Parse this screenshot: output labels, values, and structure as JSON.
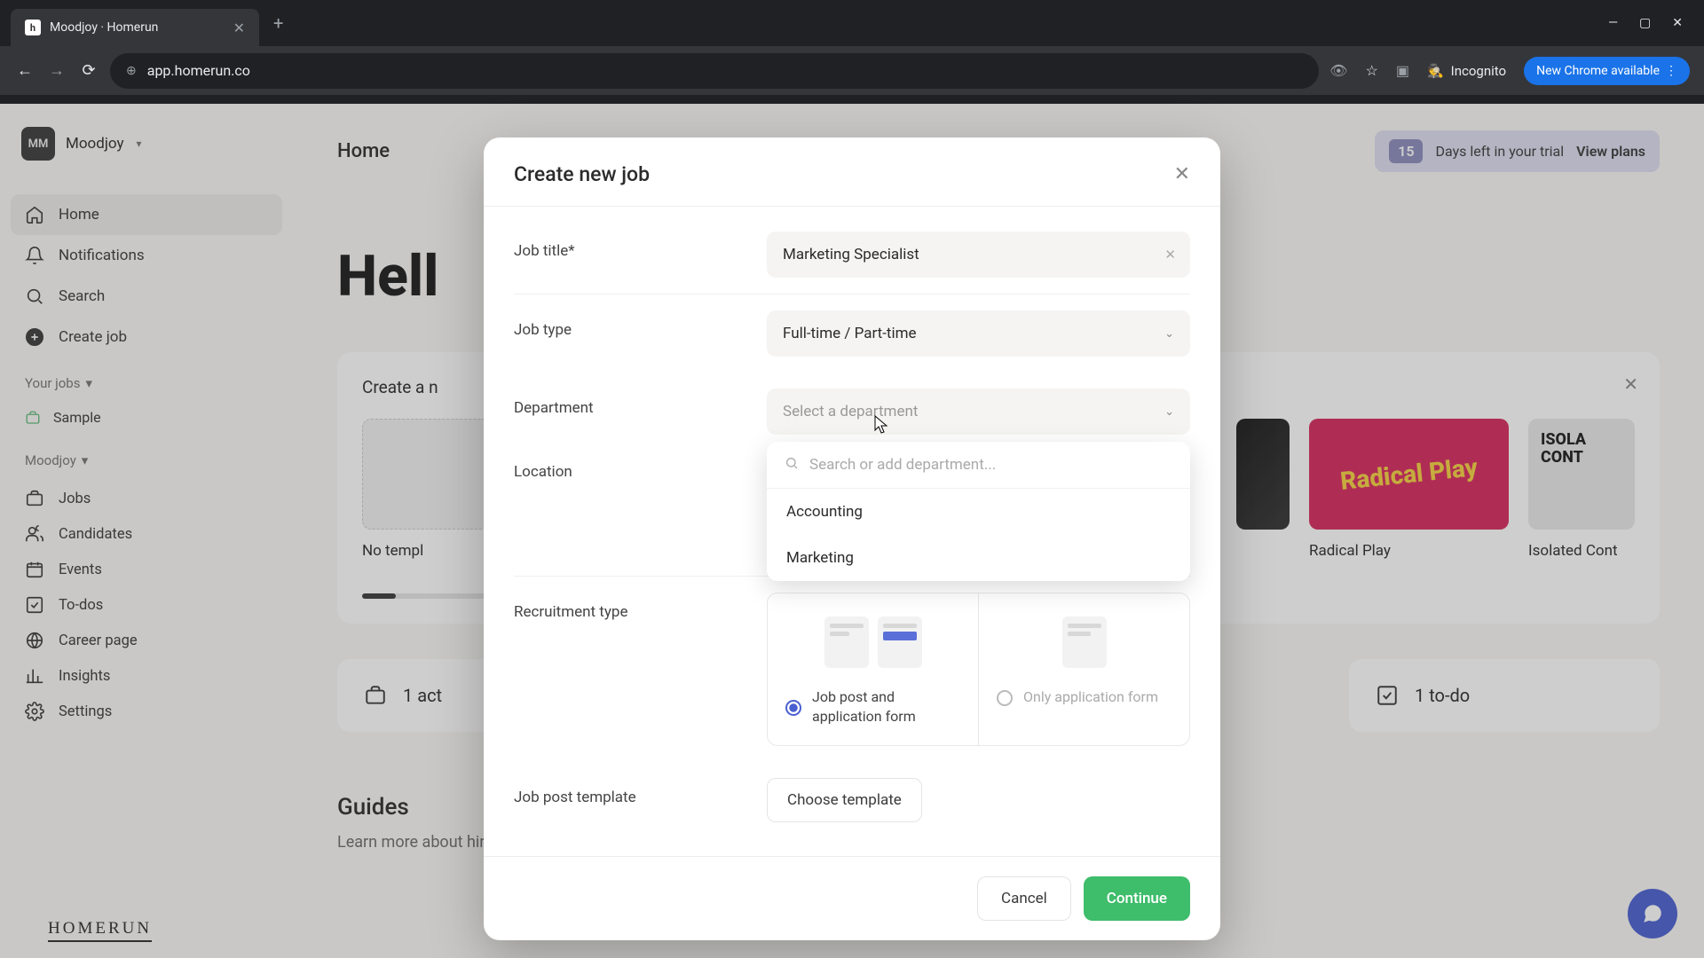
{
  "browser": {
    "tab_title": "Moodjoy · Homerun",
    "url": "app.homerun.co",
    "incognito": "Incognito",
    "update": "New Chrome available"
  },
  "sidebar": {
    "org_initials": "MM",
    "org_name": "Moodjoy",
    "nav": [
      {
        "label": "Home"
      },
      {
        "label": "Notifications"
      },
      {
        "label": "Search"
      },
      {
        "label": "Create job"
      }
    ],
    "your_jobs_label": "Your jobs",
    "sample_label": "Sample",
    "org_section": "Moodjoy",
    "second_nav": [
      {
        "label": "Jobs"
      },
      {
        "label": "Candidates"
      },
      {
        "label": "Events"
      },
      {
        "label": "To-dos"
      },
      {
        "label": "Career page"
      },
      {
        "label": "Insights"
      },
      {
        "label": "Settings"
      }
    ],
    "logo": "HOMERUN"
  },
  "header": {
    "title": "Home",
    "trial_days": "15",
    "trial_text": "Days left in your trial",
    "trial_cta": "View plans"
  },
  "main": {
    "hello": "Hell",
    "card_title": "Create a n",
    "template_placeholder": "No templ",
    "tiles": [
      {
        "label": "Radical Play",
        "text": "Radical Play"
      },
      {
        "label": "Isolated Cont",
        "text": "ISOLA\nCONT"
      }
    ],
    "stats": [
      {
        "label": "1 act"
      },
      {
        "label": "1 to-do"
      }
    ],
    "guides_title": "Guides",
    "guides_sub": "Learn more about hiring mindfully by reading our guides"
  },
  "modal": {
    "title": "Create new job",
    "fields": {
      "job_title_label": "Job title*",
      "job_title_value": "Marketing Specialist",
      "job_type_label": "Job type",
      "job_type_value": "Full-time / Part-time",
      "department_label": "Department",
      "department_placeholder": "Select a department",
      "location_label": "Location",
      "recruitment_label": "Recruitment type",
      "template_label": "Job post template"
    },
    "dropdown": {
      "search_placeholder": "Search or add department...",
      "options": [
        "Accounting",
        "Marketing"
      ]
    },
    "recruitment": {
      "opt1": "Job post and application form",
      "opt2": "Only application form"
    },
    "template_btn": "Choose template",
    "cancel": "Cancel",
    "continue": "Continue"
  }
}
